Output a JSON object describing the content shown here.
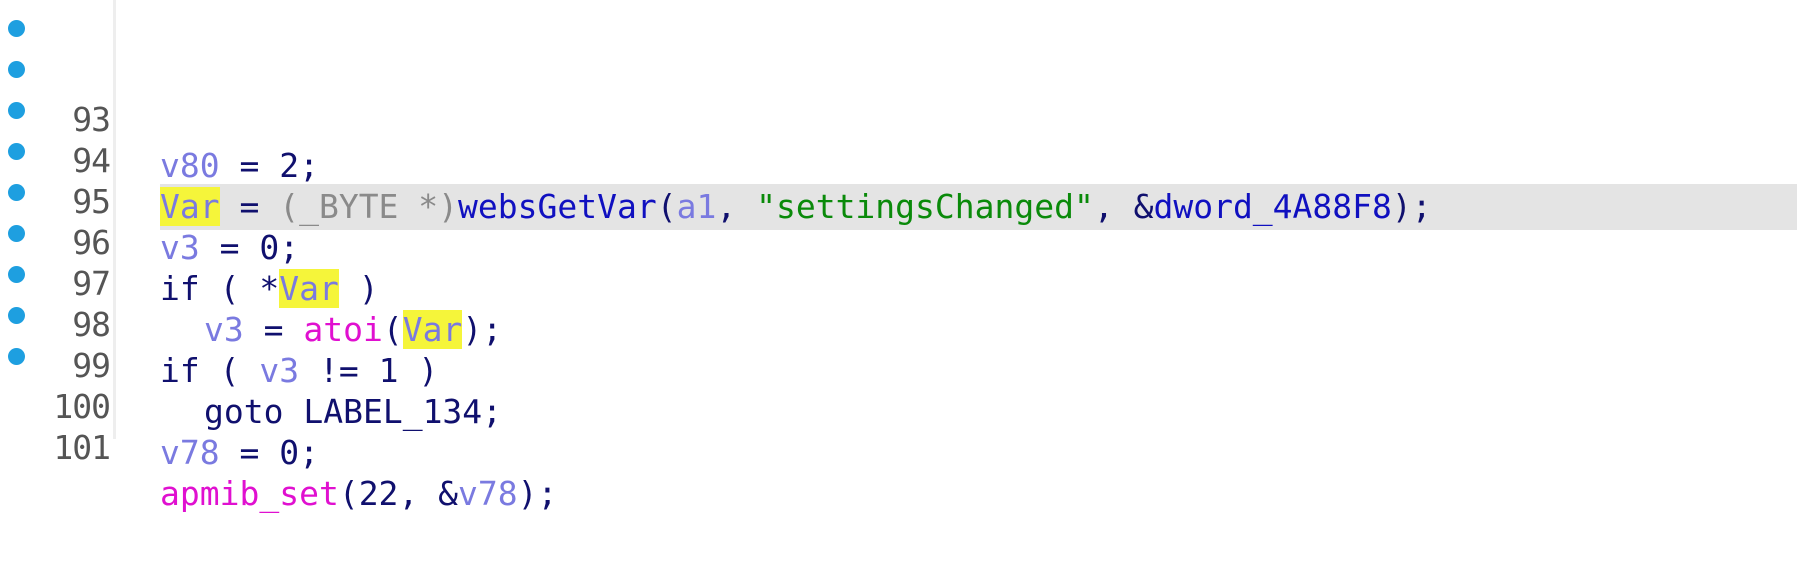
{
  "accent": {
    "breakpoint": "#1e9fe0",
    "highlight_word": "#f5f53a",
    "current_line": "#e4e4e4"
  },
  "lines": [
    {
      "num": "93"
    },
    {
      "num": "94"
    },
    {
      "num": "95"
    },
    {
      "num": "96"
    },
    {
      "num": "97"
    },
    {
      "num": "98"
    },
    {
      "num": "99"
    },
    {
      "num": "100"
    },
    {
      "num": "101"
    }
  ],
  "tokens": {
    "v80": "v80",
    "two": "2",
    "var": "Var",
    "byte_cast_open": "(_BYTE *)",
    "websGetVar": "websGetVar",
    "a1": "a1",
    "settingsChanged": "\"settingsChanged\"",
    "dword": "dword_4A88F8",
    "v3": "v3",
    "zero": "0",
    "if_kw": "if",
    "atoi": "atoi",
    "one": "1",
    "goto_kw": "goto",
    "label": "LABEL_134",
    "v78": "v78",
    "apmib_set": "apmib_set",
    "twentytwo": "22"
  }
}
